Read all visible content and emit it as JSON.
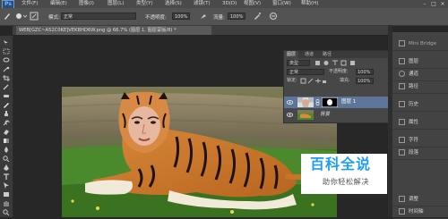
{
  "app": {
    "logo": "Ps"
  },
  "menu": [
    "文件(F)",
    "编辑(E)",
    "图像(I)",
    "图层(L)",
    "类型(Y)",
    "选择(S)",
    "滤镜(T)",
    "3D(D)",
    "视图(V)",
    "窗口(W)",
    "帮助(H)"
  ],
  "window_controls": [
    "–",
    "□",
    "×"
  ],
  "options": {
    "mode_label": "模式:",
    "mode_value": "正常",
    "opacity_label": "不透明度:",
    "opacity_value": "100%",
    "flow_label": "流量:",
    "flow_value": "100%"
  },
  "document": {
    "tab_title": "WEB[GZC~A52C0KE]VEKBHD6W.png @ 66.7% (图层 1, 图层蒙版/8) *"
  },
  "layers_panel": {
    "tabs": [
      "图层",
      "通道",
      "路径"
    ],
    "kind_label": "类型",
    "blend_mode": "正常",
    "opacity_label": "不透明度:",
    "opacity_value": "100%",
    "lock_label": "锁定:",
    "fill_label": "填充:",
    "fill_value": "100%",
    "layers": [
      {
        "name": "图层 1"
      },
      {
        "name": "背景"
      }
    ]
  },
  "dock": {
    "header": "Mini Bridge",
    "items": [
      "图层",
      "通道",
      "路径",
      "历史",
      "属性",
      "字符",
      "段落",
      "调整",
      "时间轴"
    ]
  },
  "watermark": {
    "title": "百科全说",
    "subtitle": "助你轻松解决"
  }
}
